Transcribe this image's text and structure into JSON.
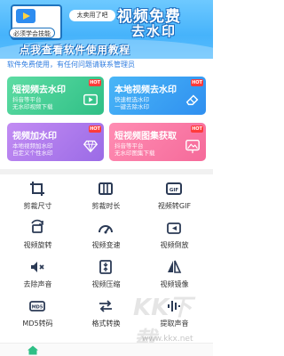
{
  "banner": {
    "tip": "太卖用了吧",
    "tag": "必须学会技能",
    "title1": "视频免费",
    "title2": "去水印",
    "subtitle": "点我查看软件使用教程"
  },
  "notice": "软件免费使用，有任何问题请联系管理员",
  "cards": [
    {
      "title": "短视频去水印",
      "desc1": "抖音等平台",
      "desc2": "无水印视频下载",
      "badge": "HOT",
      "icon": "video-play-icon"
    },
    {
      "title": "本地视频去水印",
      "desc1": "快速框选水印",
      "desc2": "一键去除水印",
      "badge": "HOT",
      "icon": "eraser-icon"
    },
    {
      "title": "视频加水印",
      "desc1": "本地视频加水印",
      "desc2": "自定义个性水印",
      "badge": "HOT",
      "icon": "diamond-icon"
    },
    {
      "title": "短视频图集获取",
      "desc1": "抖音等平台",
      "desc2": "无水印图集下载",
      "badge": "HOT",
      "icon": "image-download-icon"
    }
  ],
  "tools": [
    {
      "label": "剪裁尺寸",
      "icon": "crop-icon"
    },
    {
      "label": "剪裁时长",
      "icon": "film-cut-icon"
    },
    {
      "label": "视频转GIF",
      "icon": "gif-icon"
    },
    {
      "label": "视频旋转",
      "icon": "rotate-icon"
    },
    {
      "label": "视频变速",
      "icon": "speed-icon"
    },
    {
      "label": "视频倒放",
      "icon": "reverse-icon"
    },
    {
      "label": "去除声音",
      "icon": "mute-icon"
    },
    {
      "label": "视频压缩",
      "icon": "compress-icon"
    },
    {
      "label": "视频镜像",
      "icon": "mirror-icon"
    },
    {
      "label": "MD5转码",
      "icon": "md5-icon"
    },
    {
      "label": "格式转换",
      "icon": "format-icon"
    },
    {
      "label": "提取声音",
      "icon": "audio-wave-icon"
    }
  ],
  "watermark": {
    "logo": "KK下载",
    "url": "www.kkx.net"
  },
  "nav": {
    "home_icon": "home-icon"
  },
  "colors": {
    "accent": "#2f7de1",
    "icon": "#2b3a55"
  }
}
